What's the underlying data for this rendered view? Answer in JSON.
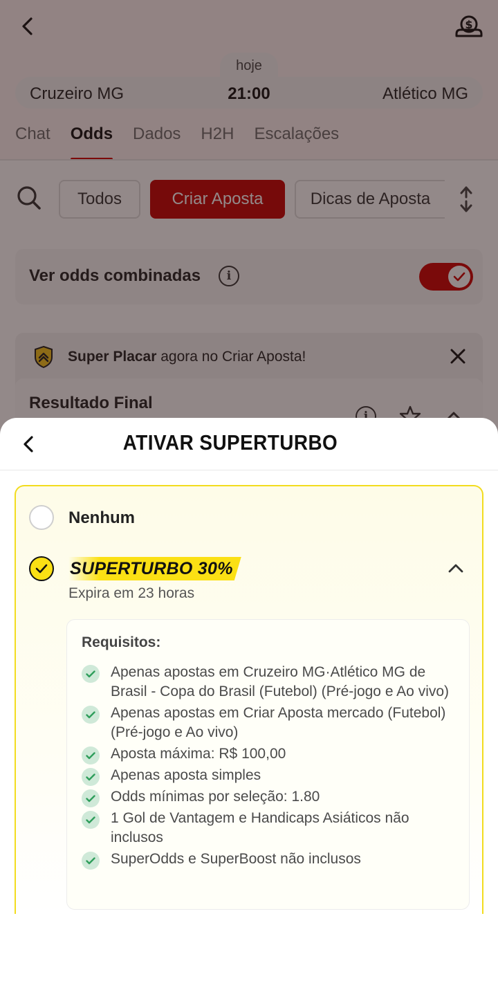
{
  "header": {
    "date_label": "hoje",
    "home_team": "Cruzeiro MG",
    "match_time": "21:00",
    "away_team": "Atlético MG"
  },
  "tabs": [
    {
      "label": "Chat",
      "active": false
    },
    {
      "label": "Odds",
      "active": true
    },
    {
      "label": "Dados",
      "active": false
    },
    {
      "label": "H2H",
      "active": false
    },
    {
      "label": "Escalações",
      "active": false
    }
  ],
  "filters": {
    "chips": [
      {
        "label": "Todos",
        "active": false
      },
      {
        "label": "Criar Aposta",
        "active": true
      },
      {
        "label": "Dicas de Aposta",
        "active": false
      }
    ]
  },
  "combined_odds": {
    "label": "Ver odds combinadas",
    "enabled": true
  },
  "promo": {
    "bold_text": "Super Placar",
    "text": " agora no Criar Aposta!",
    "market_title": "Resultado Final"
  },
  "sheet": {
    "title": "ATIVAR SUPERTURBO",
    "options": [
      {
        "label": "Nenhum",
        "selected": false
      },
      {
        "label": "SUPERTURBO 30%",
        "selected": true,
        "expiry": "Expira em 23 horas"
      }
    ],
    "requirements_title": "Requisitos:",
    "requirements": [
      "Apenas apostas em Cruzeiro MG·Atlético MG de Brasil - Copa do Brasil (Futebol) (Pré-jogo e Ao vivo)",
      "Apenas apostas em Criar Aposta mercado (Futebol) (Pré-jogo e Ao vivo)",
      "Aposta máxima: R$ 100,00",
      "Apenas aposta simples",
      "Odds mínimas por seleção: 1.80",
      "1 Gol de Vantagem e Handicaps Asiáticos não inclusos",
      "SuperOdds e SuperBoost não inclusos"
    ]
  },
  "colors": {
    "brand_red": "#c40000",
    "boost_yellow": "#fbe014",
    "check_green": "#2f9e5b"
  },
  "icons": [
    "back-arrow-icon",
    "money-bag-icon",
    "search-icon",
    "sort-icon",
    "info-icon",
    "shield-icon",
    "close-icon",
    "star-icon",
    "check-icon",
    "chevron-up-icon"
  ]
}
